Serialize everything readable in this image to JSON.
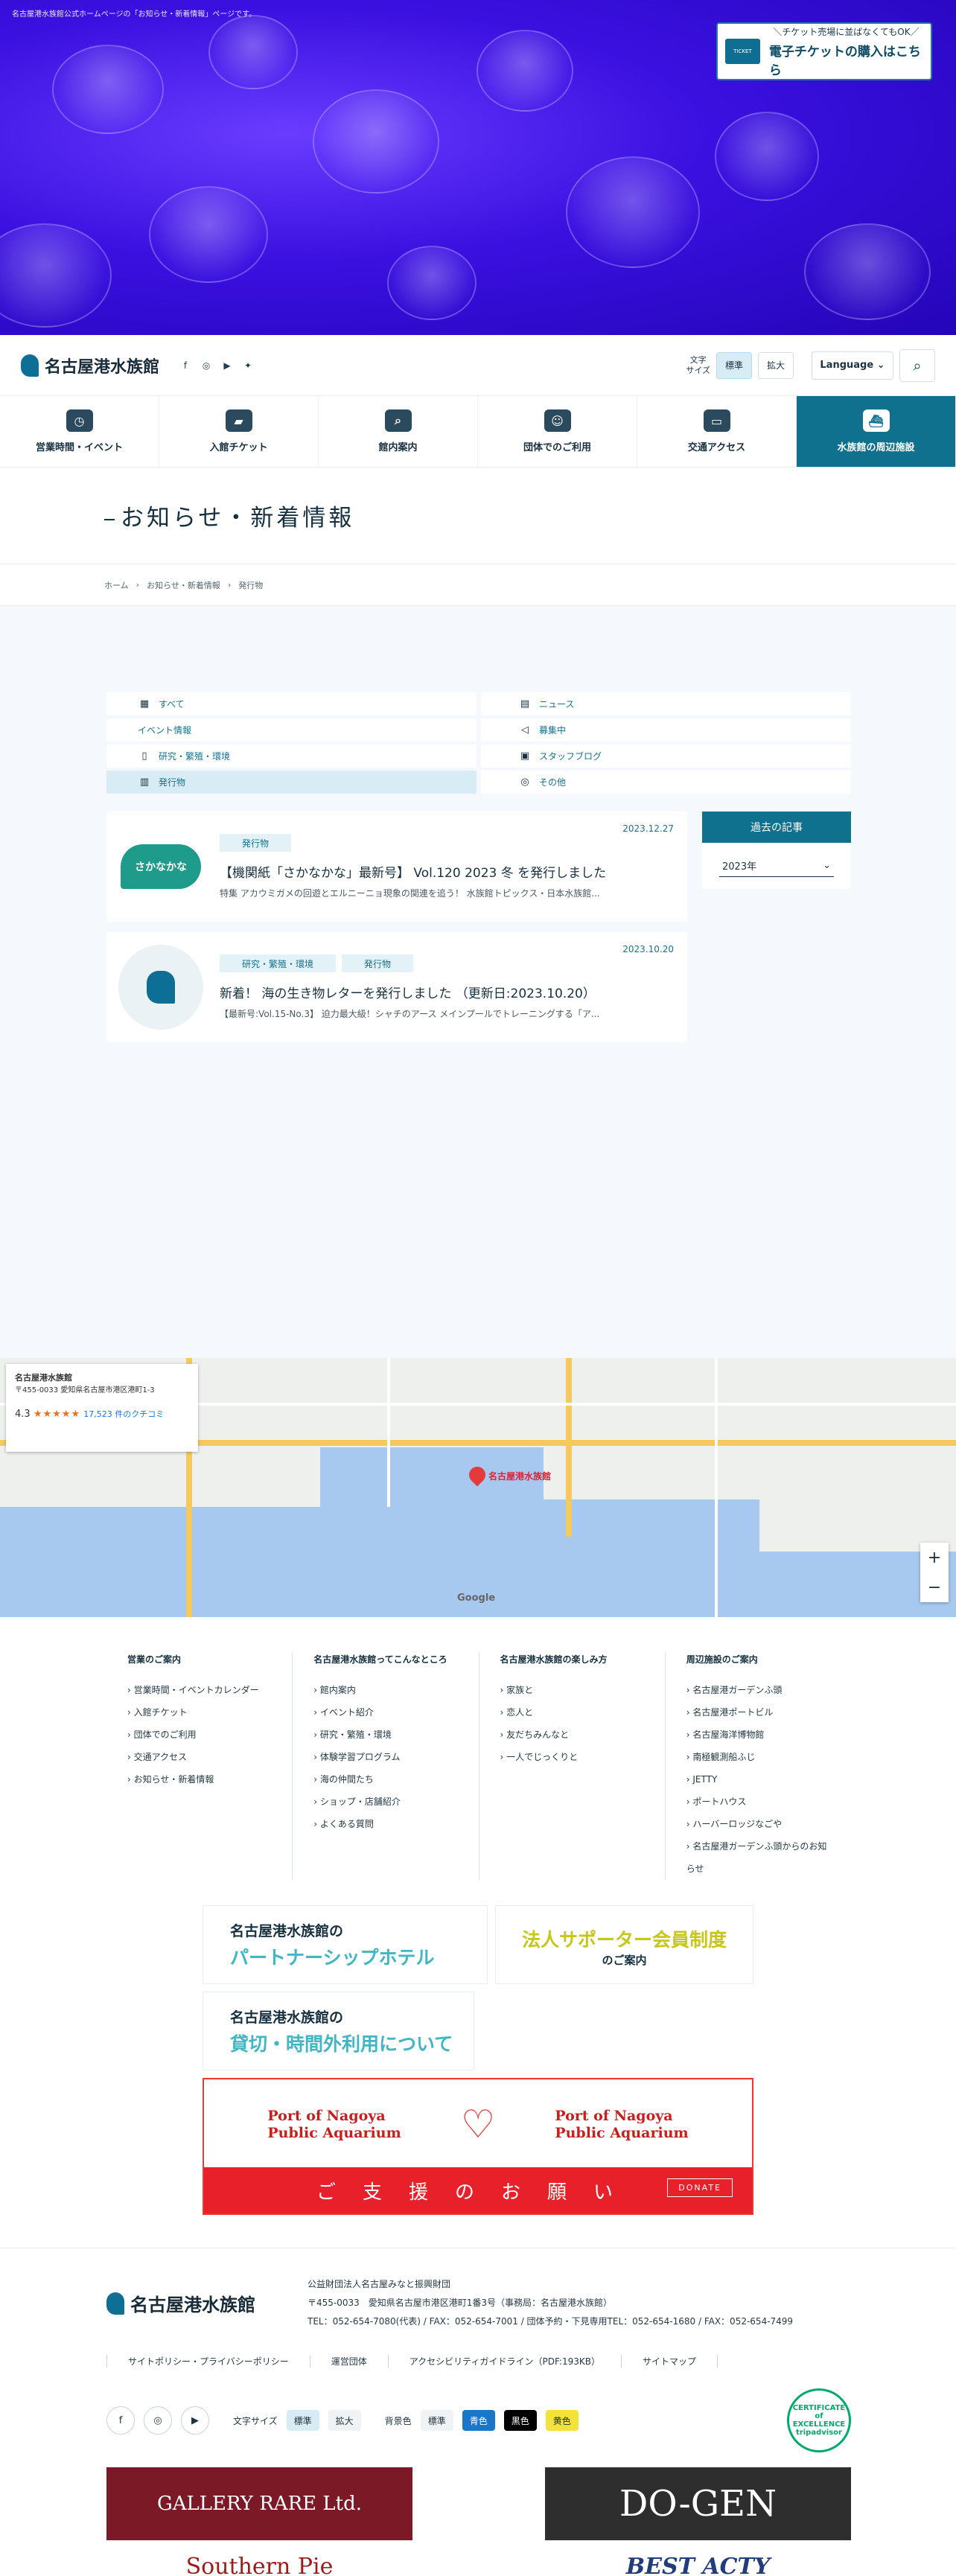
{
  "hero": {
    "caption": "名古屋港水族館公式ホームページの「お知らせ・新着情報」ページです。",
    "ticket_icon": "TICKET",
    "ticket_line1": "＼チケット売場に並ばなくてもOK／",
    "ticket_line2": "電子チケットの購入はこちら"
  },
  "header": {
    "logo_text": "名古屋港水族館",
    "font_size_label": "文字\nサイズ",
    "font_standard": "標準",
    "font_large": "拡大",
    "language": "Language"
  },
  "gnav": [
    {
      "label": "営業時間・イベント",
      "icon": "clock-icon",
      "glyph": "◷"
    },
    {
      "label": "入館チケット",
      "icon": "ticket-icon",
      "glyph": "▰"
    },
    {
      "label": "館内案内",
      "icon": "map-search-icon",
      "glyph": "⌕"
    },
    {
      "label": "団体でのご利用",
      "icon": "group-icon",
      "glyph": "☺"
    },
    {
      "label": "交通アクセス",
      "icon": "bus-icon",
      "glyph": "▭"
    },
    {
      "label": "水族館の周辺施設",
      "icon": "ship-icon",
      "glyph": "⛴"
    }
  ],
  "page_title": "お知らせ・新着情報",
  "breadcrumb": [
    "ホーム",
    "お知らせ・新着情報",
    "発行物"
  ],
  "categories": [
    {
      "label": "すべて",
      "icon": "grid-icon",
      "glyph": "▦"
    },
    {
      "label": "ニュース",
      "icon": "document-icon",
      "glyph": "▤"
    },
    {
      "label": "イベント情報",
      "icon": "",
      "glyph": ""
    },
    {
      "label": "募集中",
      "icon": "megaphone-icon",
      "glyph": "◁"
    },
    {
      "label": "研究・繁殖・環境",
      "icon": "phone-icon",
      "glyph": "▯"
    },
    {
      "label": "スタッフブログ",
      "icon": "blog-icon",
      "glyph": "▣"
    },
    {
      "label": "発行物",
      "icon": "book-icon",
      "glyph": "▥"
    },
    {
      "label": "その他",
      "icon": "other-icon",
      "glyph": "◎"
    }
  ],
  "news": [
    {
      "date": "2023.12.27",
      "tags": [
        "発行物"
      ],
      "thumb": "さかなかな",
      "title": "【機関紙「さかなかな」最新号】 Vol.120 2023 冬 を発行しました",
      "desc": "特集 アカウミガメの回遊とエルニーニョ現象の関連を追う！ 水族館トピックス・日本水族館..."
    },
    {
      "date": "2023.10.20",
      "tags": [
        "研究・繁殖・環境",
        "発行物"
      ],
      "thumb": "",
      "title": "新着！ 海の生き物レターを発行しました （更新日:2023.10.20）",
      "desc": "【最新号:Vol.15-No.3】 迫力最大級！シャチのアース メインプールでトレーニングする「ア..."
    }
  ],
  "archive": {
    "title": "過去の記事",
    "selected": "2023年"
  },
  "map": {
    "place": "名古屋港水族館",
    "address": "〒455-0033 愛知県名古屋市港区港町1-3",
    "rating": "4.3",
    "stars": "★★★★★",
    "reviews": "17,523 件のクチコミ",
    "pin_label": "名古屋港水族館",
    "google": "Google"
  },
  "footer_nav": [
    {
      "title": "営業のご案内",
      "items": [
        "営業時間・イベントカレンダー",
        "入館チケット",
        "団体でのご利用",
        "交通アクセス",
        "お知らせ・新着情報"
      ]
    },
    {
      "title": "名古屋港水族館ってこんなところ",
      "items": [
        "館内案内",
        "イベント紹介",
        "研究・繁殖・環境",
        "体験学習プログラム",
        "海の仲間たち",
        "ショップ・店舗紹介",
        "よくある質問"
      ]
    },
    {
      "title": "名古屋港水族館の楽しみ方",
      "items": [
        "家族と",
        "恋人と",
        "友だちみんなと",
        "一人でじっくりと"
      ]
    },
    {
      "title": "周辺施設のご案内",
      "items": [
        "名古屋港ガーデンふ頭",
        "名古屋港ポートビル",
        "名古屋海洋博物館",
        "南極観測船ふじ",
        "JETTY",
        "ポートハウス",
        "ハーバーロッジなごや",
        "名古屋港ガーデンふ頭からのお知らせ"
      ]
    }
  ],
  "banners": {
    "partner_1": "名古屋港水族館の",
    "partner_2": "パートナーシップホテル",
    "supporter_1": "法人サポーター会員制度",
    "supporter_2": "のご案内",
    "charter_1": "名古屋港水族館の",
    "charter_2": "貸切・時間外利用について",
    "donate_name": "Port of Nagoya\nPublic Aquarium",
    "donate_text": "ご支援のお願い",
    "donate_btn": "DONATE"
  },
  "footer": {
    "logo_text": "名古屋港水族館",
    "org": "公益財団法人名古屋みなと振興財団",
    "address": "〒455-0033　愛知県名古屋市港区港町1番3号（事務局：名古屋港水族館）",
    "tel": "TEL：052-654-7080(代表) / FAX：052-654-7001 / 団体予約・下見専用TEL：052-654-1680 / FAX：052-654-7499",
    "links": [
      "サイトポリシー・プライバシーポリシー",
      "運営団体",
      "アクセシビリティガイドライン（PDF:193KB）",
      "サイトマップ"
    ],
    "font_size": "文字サイズ",
    "font_standard": "標準",
    "font_large": "拡大",
    "bg_label": "背景色",
    "bg_standard": "標準",
    "bg_blue": "青色",
    "bg_black": "黒色",
    "bg_yellow": "黄色",
    "tripadvisor": "CERTIFICATE of\nEXCELLENCE\ntripadvisor"
  },
  "sponsors": [
    "GALLERY RARE Ltd.",
    "DO-GEN",
    "Southern Pie",
    "BEST ACTY"
  ]
}
